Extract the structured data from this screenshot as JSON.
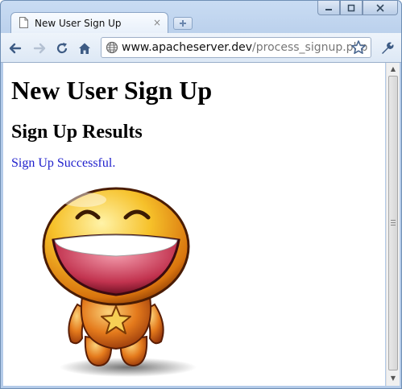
{
  "window": {
    "controls": {
      "minimize": "—",
      "maximize": "□",
      "close": "✕"
    }
  },
  "tab": {
    "title": "New User Sign Up",
    "close": "×"
  },
  "toolbar": {
    "url_host": "www.apacheserver.dev",
    "url_path": "/process_signup.php",
    "icons": [
      "back-icon",
      "forward-icon",
      "reload-icon",
      "home-icon",
      "globe-icon",
      "star-icon",
      "wrench-icon"
    ]
  },
  "page": {
    "heading": "New User Sign Up",
    "subheading": "Sign Up Results",
    "message": "Sign Up Successful.",
    "message_color": "#1f1fcc"
  },
  "scrollbar": {
    "up": "▲",
    "down": "▼"
  }
}
